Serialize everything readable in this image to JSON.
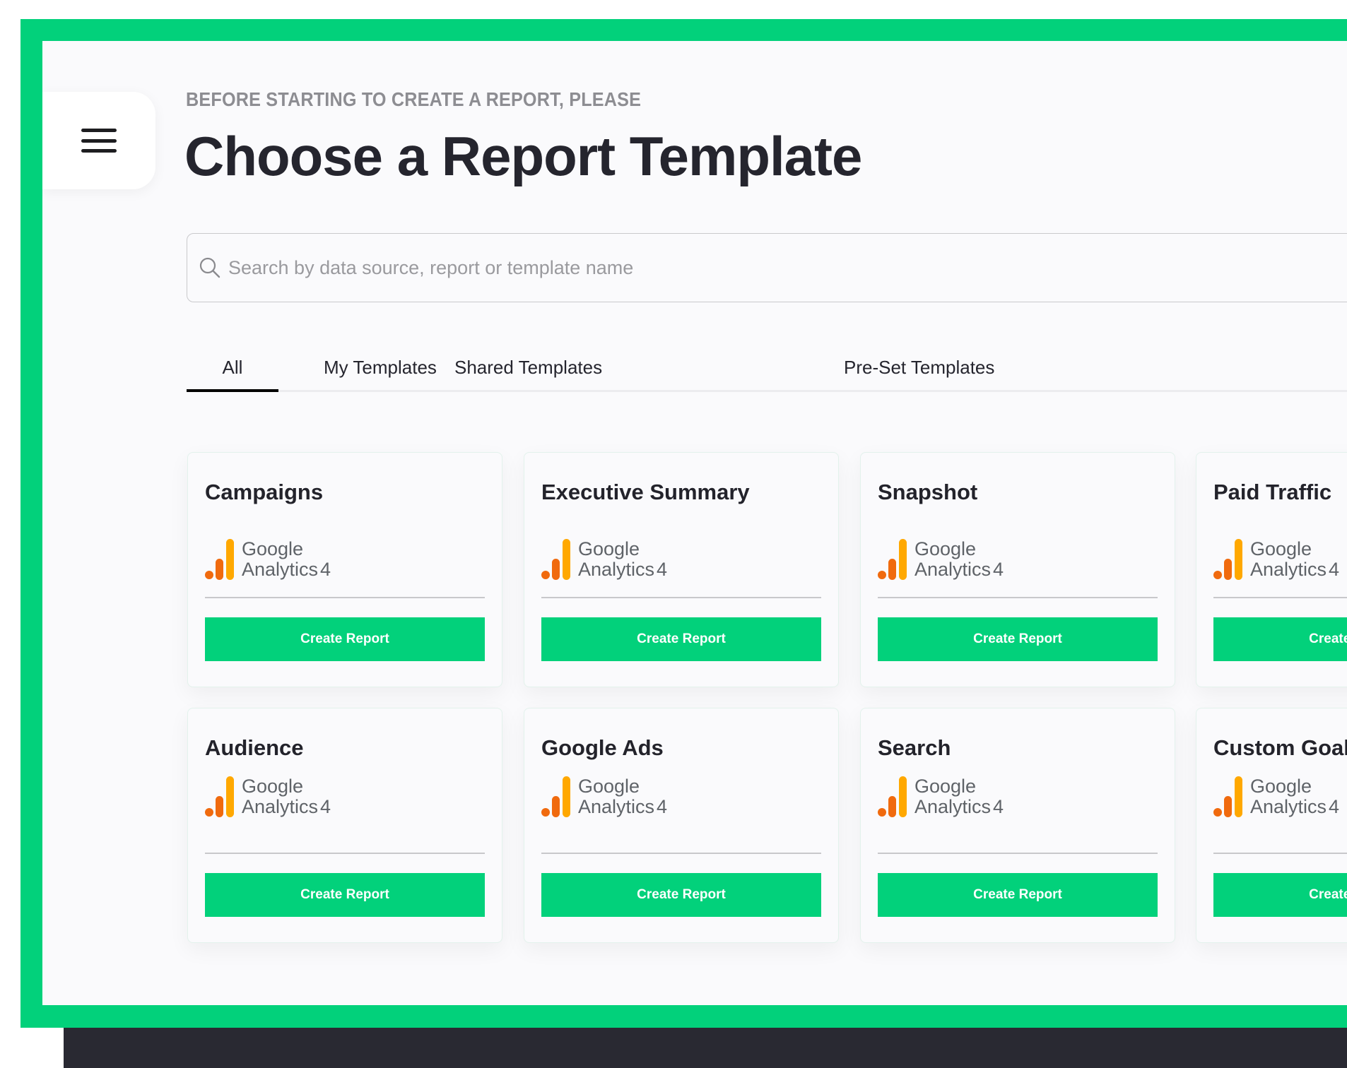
{
  "header": {
    "eyebrow": "BEFORE STARTING TO CREATE A REPORT, PLEASE",
    "title": "Choose a Report Template"
  },
  "menu": {
    "icon": "hamburger-menu-icon"
  },
  "search": {
    "placeholder": "Search by data source, report or template name",
    "value": "",
    "icon": "search-icon"
  },
  "tabs": [
    {
      "label": "All",
      "active": true
    },
    {
      "label": "My Templates",
      "active": false
    },
    {
      "label": "Shared Templates",
      "active": false
    },
    {
      "label": "Pre-Set Templates",
      "active": false
    }
  ],
  "data_source": {
    "line1": "Google",
    "line2": "Analytics",
    "version": "4"
  },
  "cards": [
    {
      "title": "Campaigns",
      "button": "Create Report"
    },
    {
      "title": "Executive Summary",
      "button": "Create Report"
    },
    {
      "title": "Snapshot",
      "button": "Create Report"
    },
    {
      "title": "Paid Traffic",
      "button": "Create Report"
    },
    {
      "title": "Audience",
      "button": "Create Report"
    },
    {
      "title": "Google Ads",
      "button": "Create Report"
    },
    {
      "title": "Search",
      "button": "Create Report"
    },
    {
      "title": "Custom Goals",
      "button": "Create Report"
    }
  ],
  "colors": {
    "accent": "#02D17B",
    "title_text": "#25252e",
    "ga_orange": "#F06A0E",
    "ga_yellow": "#FFA800",
    "dark_bar": "#292932"
  }
}
